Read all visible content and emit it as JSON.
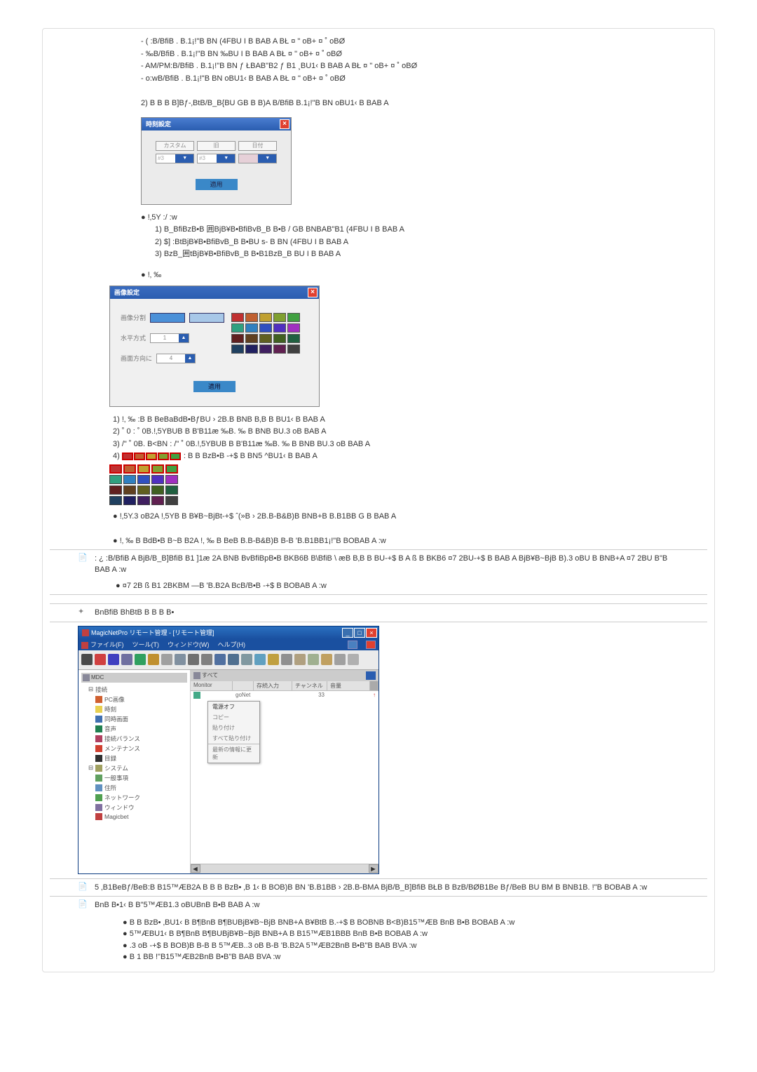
{
  "intro": {
    "lines": [
      "- ( :B/BfiB .  B.1¡!\"B BN (4FBU I  B BAB A BŁ ¤ \" oB+ ¤ ˚ oBØ",
      "- ‰B/BfiB .  B.1¡!\"B BN ‰BU I  B BAB A BŁ ¤ \" oB+ ¤ ˚ oBØ",
      "- AM/PM:B/BfiB .  B.1¡!\"B BN ƒ ŁBAB\"B2 ƒ  B1 ¸BU1‹  B BAB A BŁ ¤ \" oB+ ¤ ˚ oBØ",
      "- o:wB/BfiB .  B.1¡!\"B BN oBU1‹  B BAB A BŁ ¤ \" oB+ ¤ ˚ oBØ"
    ],
    "item2": "2) B B B B]Bƒ-‚BtB/B_B{BU GB B B)A B/BfiB B.1¡!\"B BN oBU1‹  B BAB A"
  },
  "dialog1": {
    "title": "時刻設定",
    "row1": [
      "カスタム",
      "旧",
      "日付"
    ],
    "ctrl_num": "#3",
    "ok": "適用"
  },
  "sec_a": {
    "bullet": "!‚5Y :/ :w",
    "lines": [
      "1) B_BfiBzB•B 囲BjB¥B•BfiBvB_B B•B /  GB BNBAB\"B1 (4FBU I  B BAB A",
      "2) $] :BtBjB¥B•BfiBvB_B B•BU s- B BN (4FBU I  B BAB A",
      "3) BzB_囲tBjB¥B•BfiBvB_B B•B1BzB_B BU I  B BAB A"
    ]
  },
  "dialog2": {
    "bullet": "!‚ ‰",
    "title": "画像設定",
    "row_labels": [
      "画像分割",
      "水平方式",
      "画面方向に"
    ],
    "num1": "1",
    "num4": "4",
    "ok": "適用"
  },
  "sec_b": {
    "lines": [
      "1) !‚ ‰       :B B BeBaBdB•BƒBU › 2B.B BNB B‚B B BU1‹  B BAB A",
      "2)      ˚ 0      :   ˚ 0B.!‚5YBUB B B'B11æ ‰B. ‰  B BNB BU.3 oB BAB A",
      "3) /\"  ˚ 0B.  B<BN   : /\"  ˚ 0B.!‚5YBUB B B'B11æ ‰B. ‰  B BNB BU.3 oB BAB A"
    ],
    "line4_pre": "4) ",
    "line4_post": " : B B BzB•B -+$ B BN5  ^BU1‹  B BAB A"
  },
  "sec_c": {
    "l1": "!‚5Y.3 oB2A !‚5YB B B¥B~BjBt-+$  ˆ(»B  › 2B.B-B&B)B BNB+B B.B1BB G  B BAB A",
    "l2": "!‚ ‰  B BdB•B B~B B2A !‚  ‰  B BeB B.B-B&B)B B-B    'B.B1BB1¡!\"B BOBAB A :w"
  },
  "row3": {
    "main": ": ¿  :B/BfiB A BjB/B_B]BfiB B1 ]1æ   2A   BNB BvBfiBpB•B BKB6B B\\BfiB  \\ æB B‚B B BU-+$ B A  ß  B BKB6 ¤7 2BU-+$ B BAB A BjB¥B~BjB B).3 oBU   B BNB+A  ¤7   2BU   B\"B BAB A :w",
    "sub": "¤7   2B  ß  B1   2BKBM —B    'B.B2A BcB/B•B -+$ B BOBAB A :w"
  },
  "row4": {
    "header": "BnBfiB BhBtB B B B B•"
  },
  "app": {
    "title": "MagicNetPro リモート管理 - [リモート管理]",
    "menu": [
      "ファイル(F)",
      "ツール(T)",
      "ウィンドウ(W)",
      "ヘルプ(H)"
    ],
    "treehead": "MDC",
    "tree_root": "接続",
    "tree_items": [
      {
        "icon": "#d06030",
        "label": "PC画像"
      },
      {
        "icon": "#e8d050",
        "label": "時刻"
      },
      {
        "icon": "#4070b0",
        "label": "同時画面"
      },
      {
        "icon": "#208050",
        "label": "音声"
      },
      {
        "icon": "#b04060",
        "label": "接続バランス"
      },
      {
        "icon": "#d04030",
        "label": "メンテナンス"
      },
      {
        "icon": "#303030",
        "label": "目録"
      }
    ],
    "tree_sys": "システム",
    "tree_sys_items": [
      {
        "icon": "#60a060",
        "label": "一般事項"
      },
      {
        "icon": "#6090c0",
        "label": "住所"
      },
      {
        "icon": "#50a050",
        "label": "ネットワーク"
      },
      {
        "icon": "#8070a0",
        "label": "ウィンドウ"
      },
      {
        "icon": "#c04040",
        "label": "Magicbet"
      }
    ],
    "maintab": "すべて",
    "listcols": [
      "Monitor",
      "",
      "存続入力",
      "チャンネル",
      "音量"
    ],
    "listrow": [
      "",
      "goNet",
      "",
      "33",
      ""
    ],
    "ctxmenu": [
      "電源オフ",
      "コピー",
      "貼り付け",
      "すべて貼り付け",
      "",
      "最新の情報に更新"
    ]
  },
  "row5": {
    "text": "5  ‚B1BeBƒ/BeB:B B15™ÆB2A B B B BzB•  ‚B 1‹  B BOB)B BN    'B.B1BB › 2B.B-BMA BjB/B_B]BfiB BŁB B BzB/BØB1Be Bƒ/BeB BU  BM  B BNB1B.  !\"B BOBAB A :w"
  },
  "row6": {
    "header": "BnB B•1‹  B B\"5™ÆB1.3 oBUBnB B•B BAB A :w",
    "bullets": [
      "B B BzB•  ‚BU1‹  B B¶BnB B¶BUBjB¥B~BjB BNB+A B¥BtB B.-+$ B BOBNB B<B)B15™ÆB BnB B•B BOBAB A :w",
      "5™ÆBU1‹  B B¶BnB B¶BUBjB¥B~BjB BNB+A B B15™ÆB1BBB BnB B•B BOBAB A :w",
      ".3 oB -+$ B BOB)B B-B B 5™ÆB..3 oB B-B    'B.B2A 5™ÆB2BnB B•B\"B BAB BVA :w",
      " B 1 BB  !\"B15™ÆB2BnB B•B\"B BAB BVA :w"
    ]
  },
  "swatch_colors_d2": [
    "#c03030",
    "#c06030",
    "#c0a030",
    "#80a030",
    "#40a040",
    "#30a080",
    "#3080c0",
    "#3050c0",
    "#5030c0",
    "#a030c0",
    "#602020",
    "#604020",
    "#606020",
    "#406020",
    "#206040",
    "#204060",
    "#202060",
    "#402060",
    "#602050",
    "#404040"
  ],
  "swatch_colors_sm": [
    "#c03030",
    "#c06030",
    "#c0a030",
    "#80a030",
    "#40a040",
    "#30a080",
    "#3080c0",
    "#3050c0",
    "#5030c0",
    "#a030c0",
    "#602020",
    "#604020",
    "#606020",
    "#406020",
    "#206040",
    "#204060",
    "#202060",
    "#402060",
    "#602050",
    "#404040"
  ],
  "toolbar_icons": [
    "#4a4a4a",
    "#d04040",
    "#4040c0",
    "#7070a0",
    "#30a060",
    "#c09030",
    "#a0a0a0",
    "#8090a0",
    "#707070",
    "#808080",
    "#5070a0",
    "#507090",
    "#8098a0",
    "#60a0c0",
    "#c0a040",
    "#909090",
    "#b0a080",
    "#a0b090",
    "#c0a060",
    "#a0a0a0",
    "#b0b0b0"
  ]
}
